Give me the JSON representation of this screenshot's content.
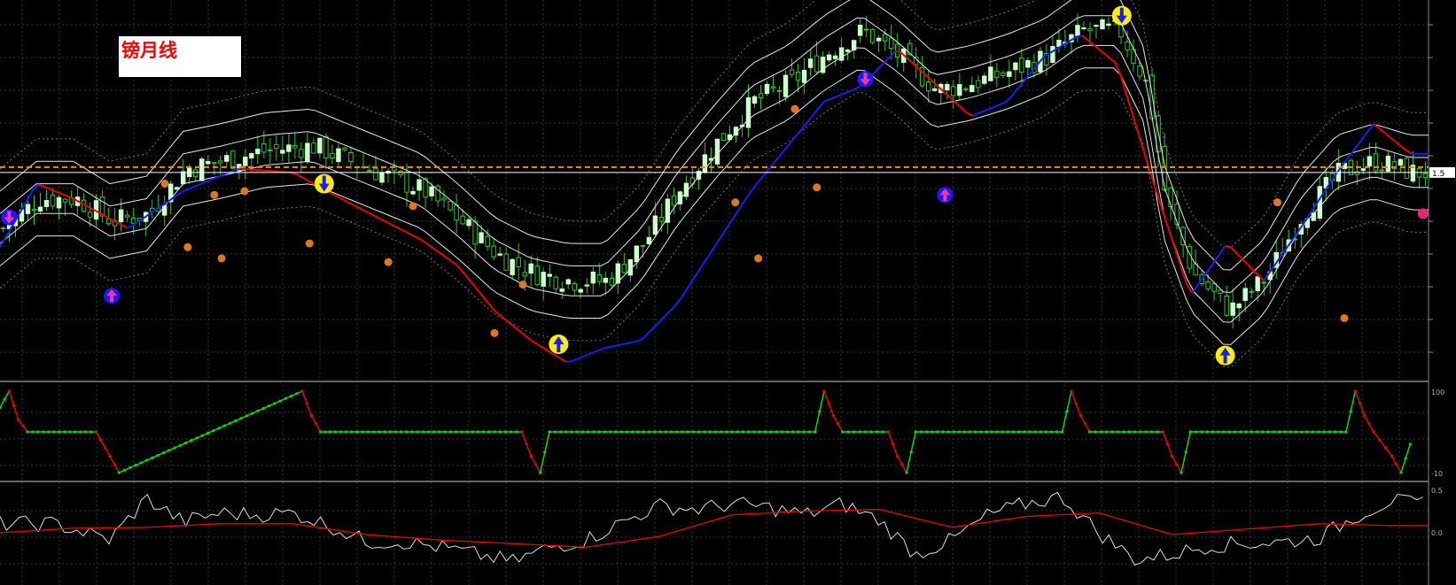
{
  "indicator": {
    "title": "镑月线"
  },
  "price_axis": {
    "current_price_label": "1.5"
  },
  "colors": {
    "background": "#000000",
    "grid": "#2b3a2b",
    "candle_up": "#ccffcc",
    "candle_down": "#22cc22",
    "band": "#e6e6e6",
    "channel": "#777777",
    "ma_up": "#1a1aff",
    "ma_down": "#ee0000",
    "price_line": "#ffffff",
    "dash_line": "#ff8800",
    "osc_up": "#00dd00",
    "osc_down": "#ee0000",
    "rsi": "#dddddd",
    "rsi_ma": "#ee0000"
  },
  "chart_data": [
    {
      "type": "line",
      "panel": "price",
      "ylim": [
        0,
        100
      ],
      "series": [
        {
          "x": [
            0,
            40,
            80,
            120,
            160,
            200,
            240,
            290,
            340,
            380,
            420,
            460,
            500,
            540,
            580,
            620,
            660,
            700,
            740,
            780,
            820,
            860,
            900,
            940,
            980,
            1020,
            1060,
            1100,
            1140,
            1180,
            1220,
            1250,
            1270,
            1300,
            1340,
            1380,
            1420,
            1460,
            1500,
            1540
          ],
          "values": [
            40,
            48,
            48,
            42,
            44,
            56,
            58,
            61,
            62,
            58,
            54,
            50,
            42,
            33,
            28,
            26,
            26,
            36,
            51,
            63,
            74,
            79,
            87,
            93,
            86,
            77,
            79,
            82,
            86,
            93,
            93,
            78,
            48,
            28,
            18,
            27,
            44,
            55,
            58,
            55
          ]
        },
        {
          "x": [
            0,
            40,
            80,
            140,
            200,
            260,
            320,
            380,
            420,
            460,
            500,
            540,
            580,
            620,
            660,
            700,
            740,
            780,
            820,
            860,
            900,
            940,
            980,
            1020,
            1060,
            1100,
            1140,
            1180,
            1220,
            1260,
            1300,
            1340,
            1380,
            1420,
            1460,
            1500,
            1540
          ],
          "values": [
            35,
            52,
            48,
            40,
            50,
            56,
            55,
            47,
            42,
            37,
            30,
            18,
            10,
            4,
            8,
            10,
            20,
            35,
            50,
            62,
            74,
            78,
            88,
            79,
            70,
            74,
            86,
            92,
            84,
            52,
            22,
            36,
            26,
            40,
            55,
            68,
            60
          ]
        }
      ]
    },
    {
      "type": "line",
      "panel": "oscillator",
      "ylim": [
        -100,
        100
      ],
      "ticks": [
        "100",
        "-10"
      ],
      "x": [
        0,
        10,
        20,
        30,
        105,
        120,
        130,
        330,
        340,
        350,
        360,
        570,
        580,
        590,
        600,
        890,
        900,
        910,
        920,
        970,
        980,
        990,
        1000,
        1160,
        1170,
        1180,
        1190,
        1270,
        1280,
        1290,
        1300,
        1470,
        1480,
        1490,
        1500,
        1520,
        1530,
        1540
      ],
      "values": [
        60,
        100,
        30,
        0,
        0,
        -60,
        -100,
        100,
        40,
        0,
        0,
        0,
        -60,
        -100,
        0,
        0,
        100,
        40,
        0,
        0,
        -60,
        -100,
        0,
        0,
        100,
        40,
        0,
        0,
        -60,
        -100,
        0,
        0,
        100,
        40,
        0,
        -60,
        -100,
        -30
      ]
    },
    {
      "type": "line",
      "panel": "rsi",
      "ylim": [
        0,
        100
      ],
      "ticks": [
        "0.5",
        "0.0"
      ],
      "series": [
        {
          "x": [
            0,
            60,
            120,
            160,
            200,
            240,
            280,
            320,
            360,
            400,
            440,
            480,
            520,
            560,
            600,
            640,
            680,
            720,
            760,
            800,
            840,
            880,
            920,
            960,
            1000,
            1040,
            1080,
            1120,
            1160,
            1200,
            1240,
            1280,
            1320,
            1360,
            1400,
            1440,
            1480,
            1520,
            1540
          ],
          "values": [
            60,
            60,
            42,
            88,
            62,
            72,
            70,
            72,
            58,
            40,
            40,
            34,
            26,
            18,
            34,
            42,
            62,
            80,
            76,
            82,
            78,
            70,
            82,
            64,
            26,
            42,
            70,
            82,
            90,
            50,
            20,
            26,
            36,
            38,
            40,
            44,
            68,
            86,
            82
          ]
        },
        {
          "x": [
            0,
            80,
            160,
            240,
            320,
            400,
            480,
            560,
            640,
            720,
            800,
            880,
            960,
            1040,
            1120,
            1200,
            1280,
            1360,
            1440,
            1520,
            1540
          ],
          "values": [
            50,
            55,
            56,
            60,
            60,
            48,
            42,
            38,
            34,
            46,
            70,
            74,
            76,
            56,
            68,
            72,
            48,
            54,
            60,
            58,
            58
          ]
        }
      ]
    }
  ]
}
